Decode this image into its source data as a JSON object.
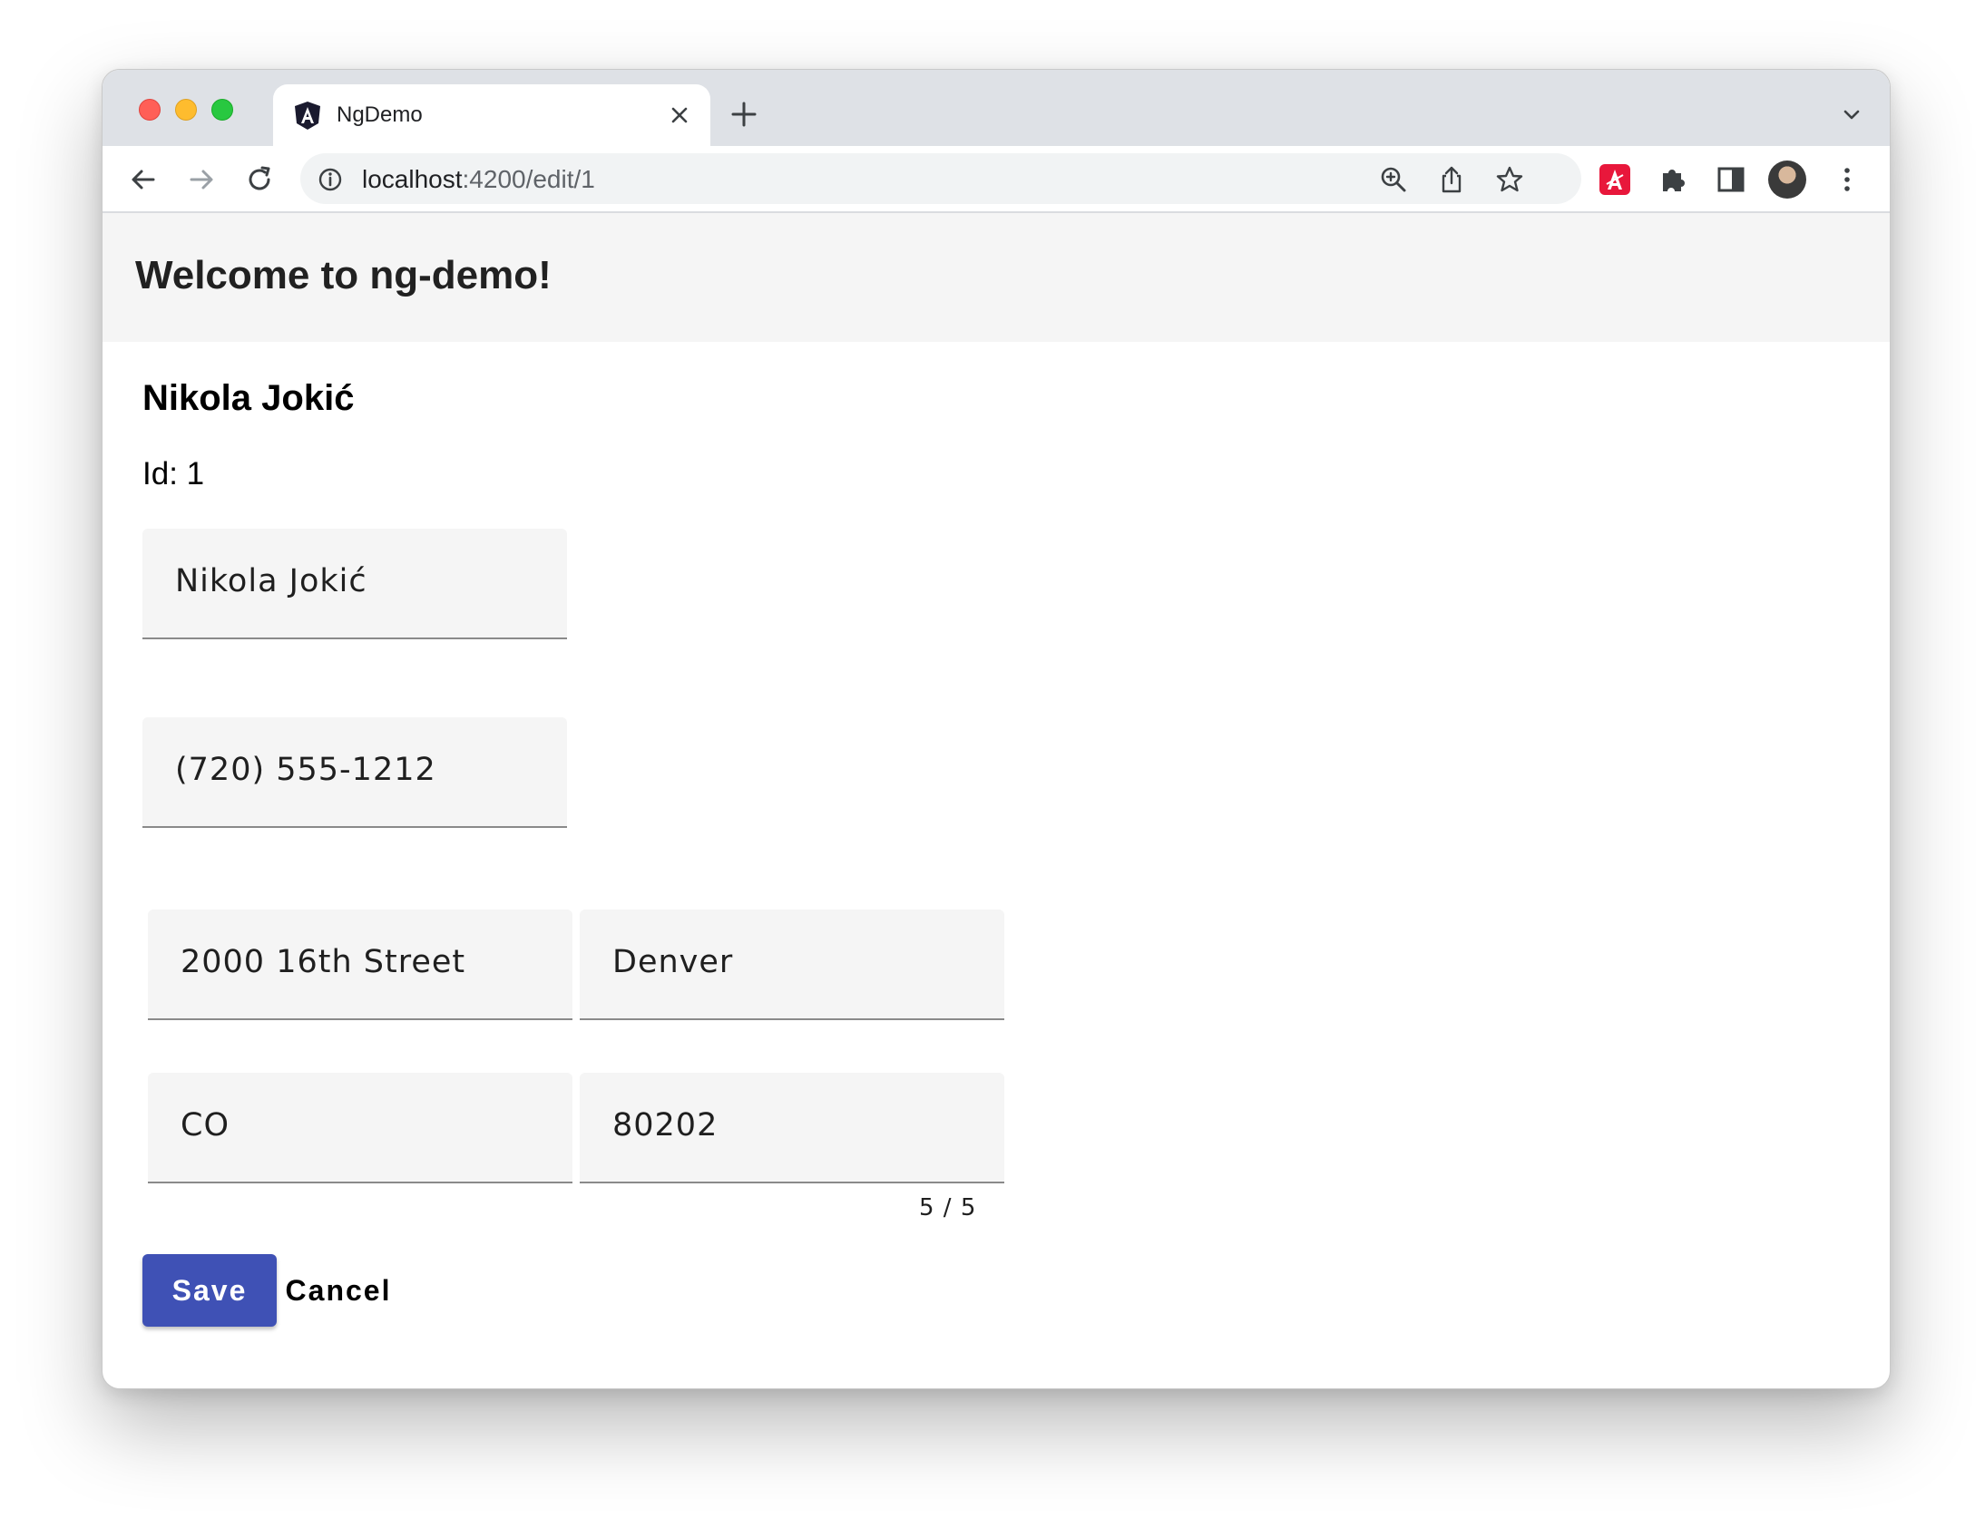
{
  "browser": {
    "tab_title": "NgDemo",
    "url_host": "localhost",
    "url_path": ":4200/edit/1"
  },
  "icons": {
    "favicon": "angular-logo-icon",
    "close": "close-icon",
    "new_tab": "plus-icon",
    "tab_list": "chevron-down-icon",
    "back": "arrow-left-icon",
    "forward": "arrow-right-icon",
    "reload": "reload-icon",
    "site_info": "info-icon",
    "zoom": "zoom-in-icon",
    "share": "share-icon",
    "bookmark": "star-icon",
    "extension": "angular-devtools-icon",
    "extensions": "puzzle-icon",
    "side_panel": "side-panel-icon",
    "profile": "avatar",
    "menu": "kebab-menu-icon"
  },
  "colors": {
    "primary": "#3f51b5",
    "header_bg": "#f5f5f5",
    "field_bg": "#f5f5f5",
    "extension_red": "#e8173b"
  },
  "app": {
    "header_title": "Welcome to ng-demo!"
  },
  "page": {
    "heading": "Nikola Jokić",
    "id_label": "Id: 1"
  },
  "form": {
    "name": "Nikola Jokić",
    "phone": "(720) 555-1212",
    "street": "2000 16th Street",
    "city": "Denver",
    "state": "CO",
    "zip": "80202",
    "zip_hint": "5 / 5"
  },
  "actions": {
    "save_label": "Save",
    "cancel_label": "Cancel"
  }
}
